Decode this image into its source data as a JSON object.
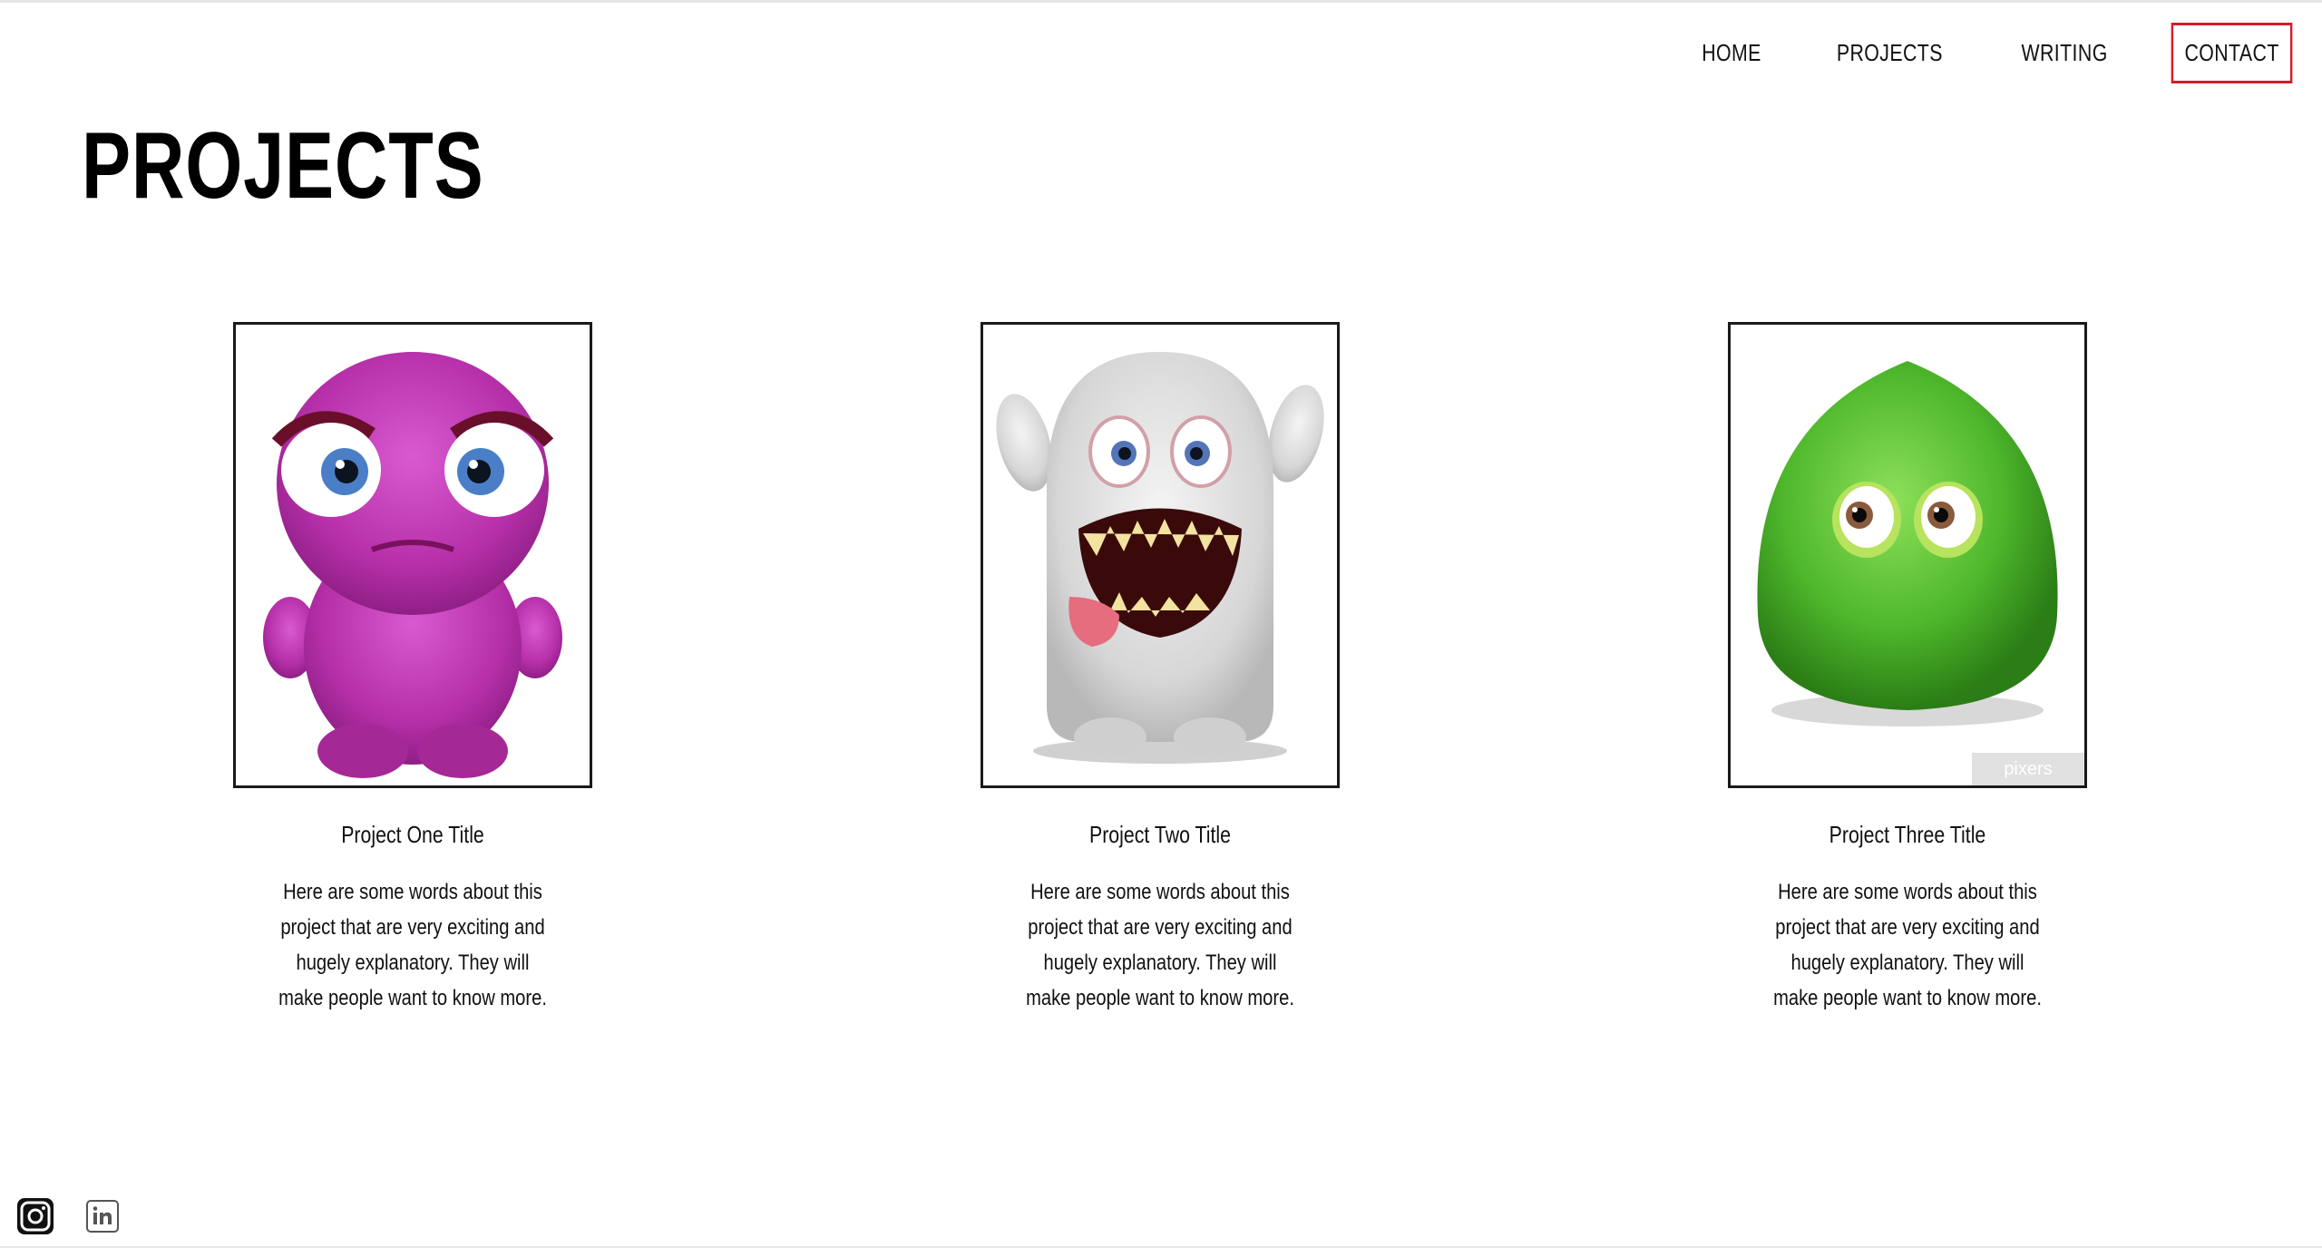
{
  "nav": {
    "items": [
      {
        "label": "HOME"
      },
      {
        "label": "PROJECTS"
      },
      {
        "label": "WRITING"
      },
      {
        "label": "CONTACT",
        "active": true
      }
    ]
  },
  "page": {
    "title": "PROJECTS"
  },
  "projects": [
    {
      "title": "Project One Title",
      "description": "Here are some words about this project that are very exciting and hugely explanatory. They will make people want to know more.",
      "image": "pink-furry-monster",
      "color": "#c236b5"
    },
    {
      "title": "Project Two Title",
      "description": "Here are some words about this project that are very exciting and hugely explanatory. They will make people want to know more.",
      "image": "white-furry-monster",
      "color": "#dcdcdc"
    },
    {
      "title": "Project Three Title",
      "description": "Here are some words about this project that are very exciting and hugely explanatory. They will make people want to know more.",
      "image": "green-furry-monster",
      "color": "#4cb82c",
      "watermark": "pixers"
    }
  ],
  "social": [
    {
      "icon": "instagram-icon"
    },
    {
      "icon": "linkedin-icon"
    }
  ],
  "colors": {
    "accent": "#d21f2a",
    "text": "#111111",
    "background": "#ffffff"
  }
}
